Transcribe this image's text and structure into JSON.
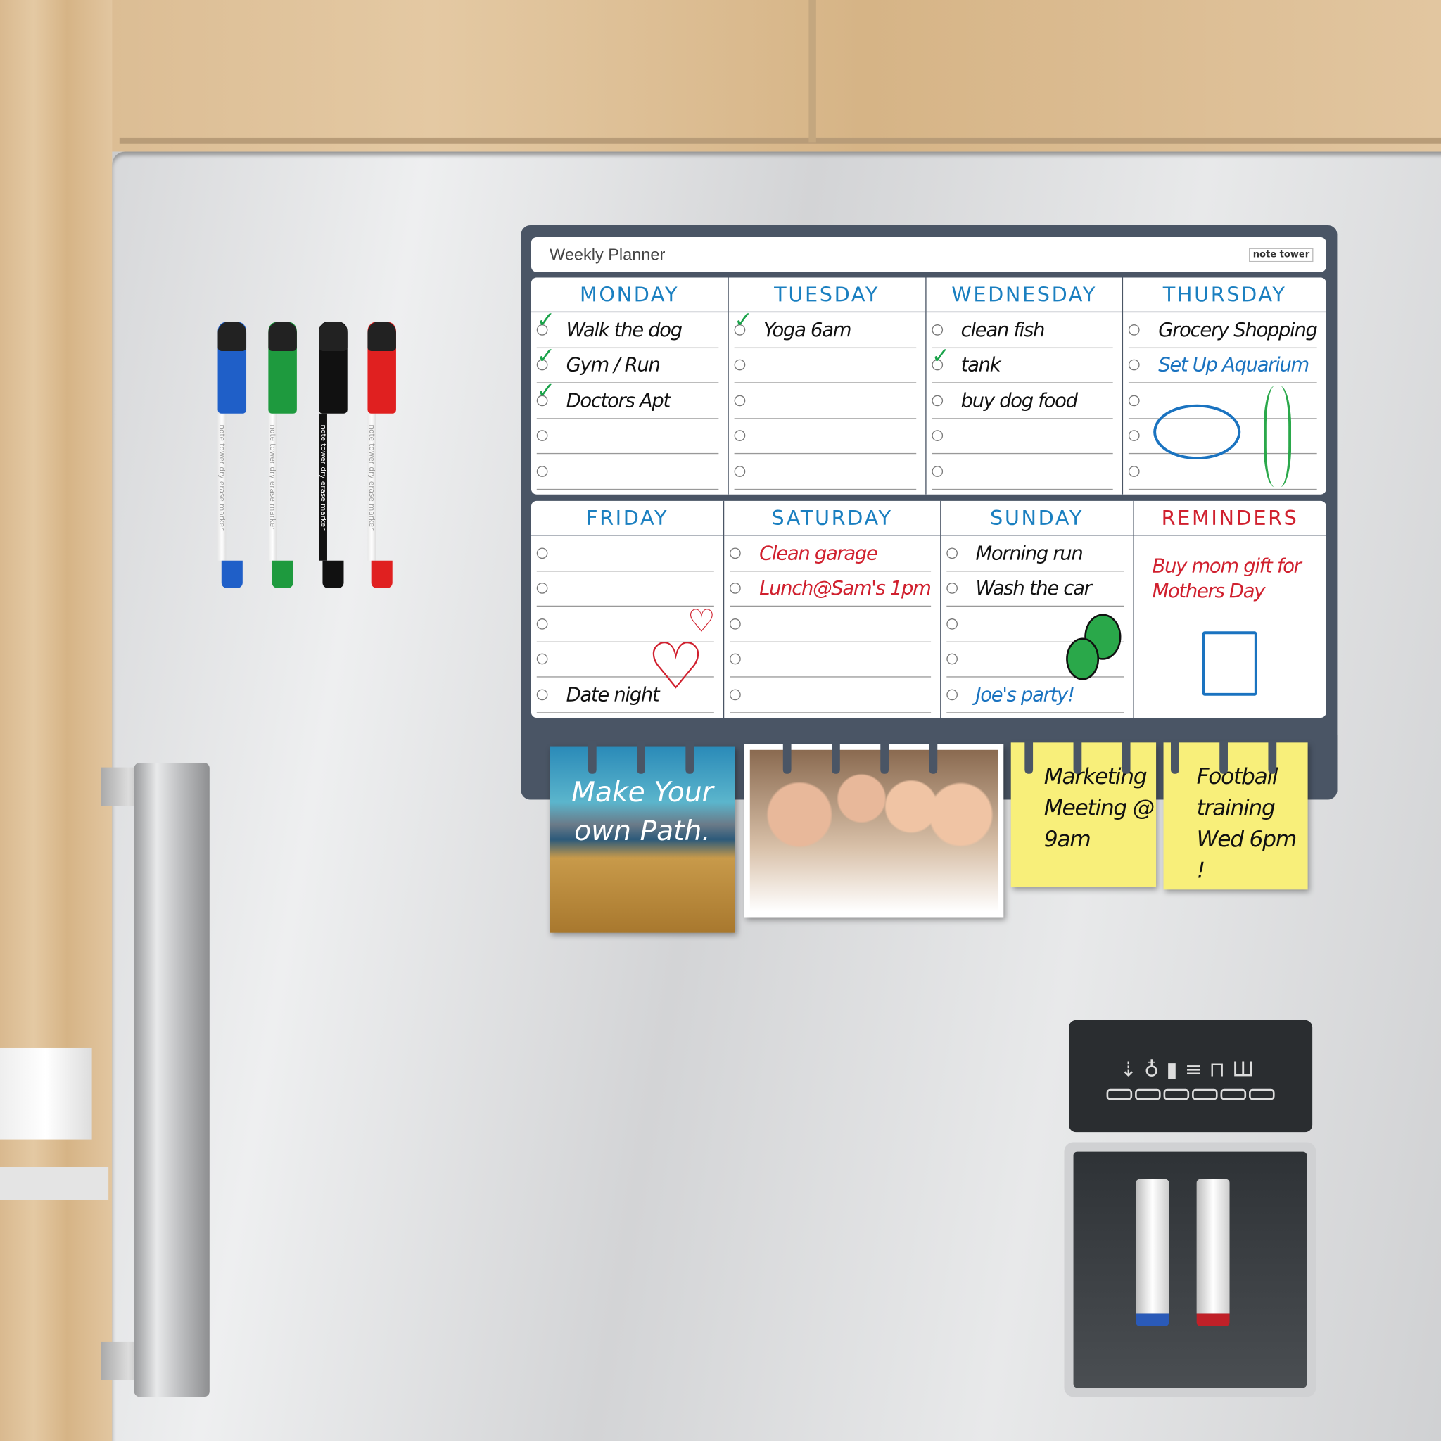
{
  "planner": {
    "title": "Weekly Planner",
    "brand": "note tower",
    "days": [
      {
        "name": "MONDAY",
        "items": [
          {
            "text": "Walk the dog",
            "checked": true,
            "color": "#111111"
          },
          {
            "text": "Gym / Run",
            "checked": true,
            "color": "#111111"
          },
          {
            "text": "Doctors Apt",
            "checked": true,
            "color": "#111111"
          },
          {
            "text": "",
            "checked": false
          },
          {
            "text": "",
            "checked": false
          }
        ]
      },
      {
        "name": "TUESDAY",
        "items": [
          {
            "text": "Yoga 6am",
            "checked": true,
            "color": "#111111"
          },
          {
            "text": "",
            "checked": false
          },
          {
            "text": "",
            "checked": false
          },
          {
            "text": "",
            "checked": false
          },
          {
            "text": "",
            "checked": false
          }
        ]
      },
      {
        "name": "WEDNESDAY",
        "items": [
          {
            "text": "clean fish",
            "checked": false,
            "color": "#111111"
          },
          {
            "text": "tank",
            "checked": true,
            "color": "#111111"
          },
          {
            "text": "buy dog food",
            "checked": false,
            "color": "#111111"
          },
          {
            "text": "",
            "checked": false
          },
          {
            "text": "",
            "checked": false
          }
        ]
      },
      {
        "name": "THURSDAY",
        "items": [
          {
            "text": "Grocery Shopping",
            "checked": false,
            "color": "#111111"
          },
          {
            "text": "Set Up Aquarium",
            "checked": false,
            "color": "#1a73c0"
          },
          {
            "text": "",
            "checked": false
          },
          {
            "text": "",
            "checked": false
          },
          {
            "text": "",
            "checked": false
          }
        ]
      },
      {
        "name": "FRIDAY",
        "items": [
          {
            "text": "",
            "checked": false
          },
          {
            "text": "",
            "checked": false
          },
          {
            "text": "",
            "checked": false
          },
          {
            "text": "",
            "checked": false
          },
          {
            "text": "Date night",
            "checked": false,
            "color": "#111111"
          }
        ]
      },
      {
        "name": "SATURDAY",
        "items": [
          {
            "text": "Clean garage",
            "checked": false,
            "color": "#d0202e"
          },
          {
            "text": "Lunch@Sam's 1pm",
            "checked": false,
            "color": "#d0202e"
          },
          {
            "text": "",
            "checked": false
          },
          {
            "text": "",
            "checked": false
          },
          {
            "text": "",
            "checked": false
          }
        ]
      },
      {
        "name": "SUNDAY",
        "items": [
          {
            "text": "Morning run",
            "checked": false,
            "color": "#111111"
          },
          {
            "text": "Wash the car",
            "checked": false,
            "color": "#111111"
          },
          {
            "text": "",
            "checked": false
          },
          {
            "text": "",
            "checked": false
          },
          {
            "text": "Joe's party!",
            "checked": false,
            "color": "#1a73c0"
          }
        ]
      }
    ],
    "reminders": {
      "name": "REMINDERS",
      "text": "Buy mom gift for Mothers Day"
    },
    "colors": {
      "day_header": "#1a7fc0",
      "reminders_header": "#d0202e",
      "frame": "#4a5565"
    }
  },
  "cards": {
    "photo_quote": "Make Your own Path.",
    "sticky1": "Marketing Meeting @ 9am",
    "sticky2": "Football training Wed 6pm !"
  },
  "markers": [
    {
      "color": "#1f5fc8",
      "label": "note tower dry erase marker"
    },
    {
      "color": "#1e9a3e",
      "label": "note tower dry erase marker"
    },
    {
      "color": "#111111",
      "label": "note tower dry erase marker"
    },
    {
      "color": "#e02020",
      "label": "note tower dry erase marker"
    }
  ],
  "dispenser": {
    "icons": [
      "water-icon",
      "light-icon",
      "temperature-icon",
      "filter-icon",
      "lock-icon",
      "ice-icon"
    ]
  }
}
